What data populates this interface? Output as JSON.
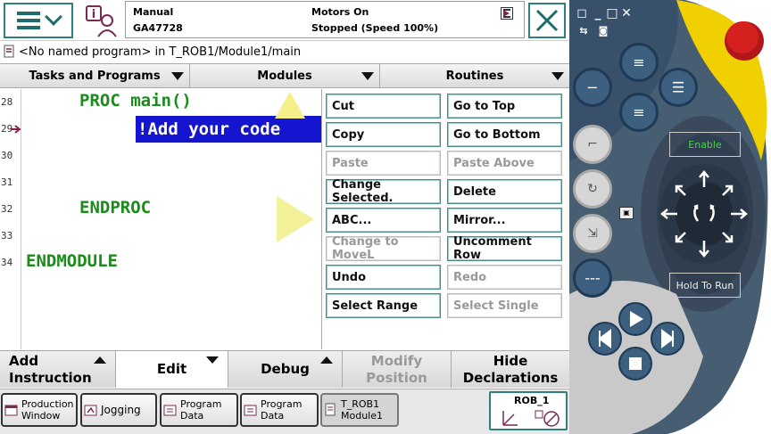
{
  "status": {
    "mode": "Manual",
    "controller": "GA47728",
    "motors": "Motors On",
    "state": "Stopped (Speed 100%)"
  },
  "path": "<No named program> in T_ROB1/Module1/main",
  "tabs": [
    {
      "label": "Tasks and Programs"
    },
    {
      "label": "Modules"
    },
    {
      "label": "Routines"
    }
  ],
  "editor": {
    "lines": [
      {
        "num": "28",
        "code": "PROC main()"
      },
      {
        "num": "29",
        "code": "!Add your code"
      },
      {
        "num": "30",
        "code": ""
      },
      {
        "num": "31",
        "code": ""
      },
      {
        "num": "32",
        "code": "ENDPROC"
      },
      {
        "num": "33",
        "code": ""
      },
      {
        "num": "34",
        "code": "ENDMODULE"
      }
    ]
  },
  "edit_menu": {
    "left": [
      {
        "label": "Cut",
        "enabled": true
      },
      {
        "label": "Copy",
        "enabled": true
      },
      {
        "label": "Paste",
        "enabled": false
      },
      {
        "label": "Change Selected.",
        "enabled": true
      },
      {
        "label": "ABC...",
        "enabled": true
      },
      {
        "label": "Change to MoveL",
        "enabled": false
      },
      {
        "label": "Undo",
        "enabled": true
      },
      {
        "label": "Select Range",
        "enabled": true
      }
    ],
    "right": [
      {
        "label": "Go to Top",
        "enabled": true
      },
      {
        "label": "Go to Bottom",
        "enabled": true
      },
      {
        "label": "Paste Above",
        "enabled": false
      },
      {
        "label": "Delete",
        "enabled": true
      },
      {
        "label": "Mirror...",
        "enabled": true
      },
      {
        "label": "Uncomment Row",
        "enabled": true
      },
      {
        "label": "Redo",
        "enabled": false
      },
      {
        "label": "Select Single",
        "enabled": false
      }
    ]
  },
  "bottom": {
    "add_instruction": "Add\nInstruction",
    "edit": "Edit",
    "debug": "Debug",
    "modify_position": "Modify\nPosition",
    "hide_declarations": "Hide\nDeclarations"
  },
  "taskbar": {
    "production_window": "Production\nWindow",
    "jogging": "Jogging",
    "program_data_1": "Program\nData",
    "program_data_2": "Program\nData",
    "t_rob1": "T_ROB1\nModule1",
    "rob": "ROB_1"
  },
  "pendant": {
    "enable": "Enable",
    "hold_to_run": "Hold To Run"
  },
  "colors": {
    "accent": "#2f7f7f",
    "keyword": "#1a8c1a",
    "selection": "#1515d0",
    "pendant_blue": "#3d5f80",
    "joystick_yellow": "#f0d000",
    "estop_red": "#d4201e"
  }
}
